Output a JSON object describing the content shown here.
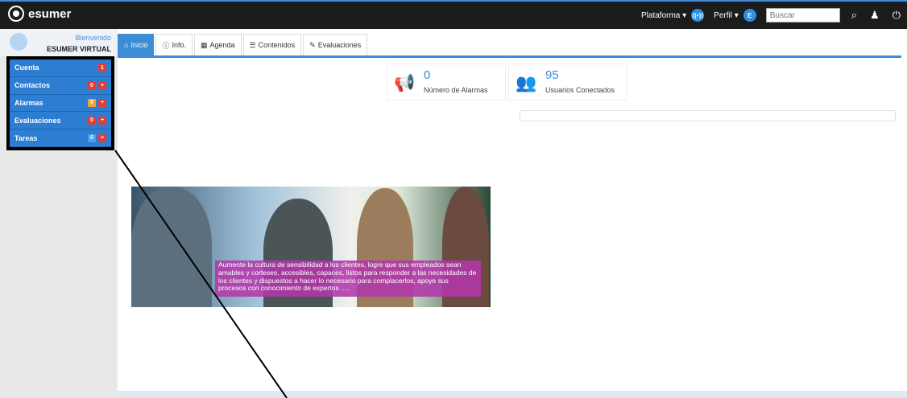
{
  "brand": {
    "name": "esumer"
  },
  "top_nav": {
    "platform_label": "Plataforma ▾",
    "profile_label": "Perfil ▾",
    "profile_avatar_letter": "E",
    "search_placeholder": "Buscar"
  },
  "user": {
    "welcome": "Bienvenido",
    "name": "ESUMER VIRTUAL"
  },
  "sidebar": {
    "items": [
      {
        "label": "Cuenta",
        "badges": [
          "1"
        ]
      },
      {
        "label": "Contactos",
        "badges": [
          "0",
          "+"
        ]
      },
      {
        "label": "Alarmas",
        "badges": [
          "0",
          "+"
        ]
      },
      {
        "label": "Evaluaciones",
        "badges": [
          "0",
          "+"
        ]
      },
      {
        "label": "Tareas",
        "badges": [
          "0",
          "+"
        ]
      }
    ]
  },
  "tabs": [
    {
      "label": "Inicio",
      "icon": "home-icon"
    },
    {
      "label": "Info.",
      "icon": "info-icon"
    },
    {
      "label": "Agenda",
      "icon": "calendar-icon"
    },
    {
      "label": "Contenidos",
      "icon": "list-icon"
    },
    {
      "label": "Evaluaciones",
      "icon": "pencil-icon"
    }
  ],
  "stats": [
    {
      "value": "0",
      "label": "Número de Alarmas",
      "icon": "megaphone-icon"
    },
    {
      "value": "95",
      "label": "Usuarios Conectados",
      "icon": "users-icon"
    }
  ],
  "banner": {
    "text": "Aumente la cultura de sensibilidad a los clientes, logre que sus empleados sean amables y corteses, accesibles, capaces, listos para responder a las necesidades de los clientes y dispuestos a hacer lo necesario para complacerlos, apoye sus procesos con conocimiento de expertos ....."
  },
  "colors": {
    "accent": "#3c8dd5",
    "sidebar_menu": "#2d7dd2",
    "badge_red": "#e43c32",
    "badge_orange": "#f2a231",
    "banner_text_background": "#b238aa"
  }
}
